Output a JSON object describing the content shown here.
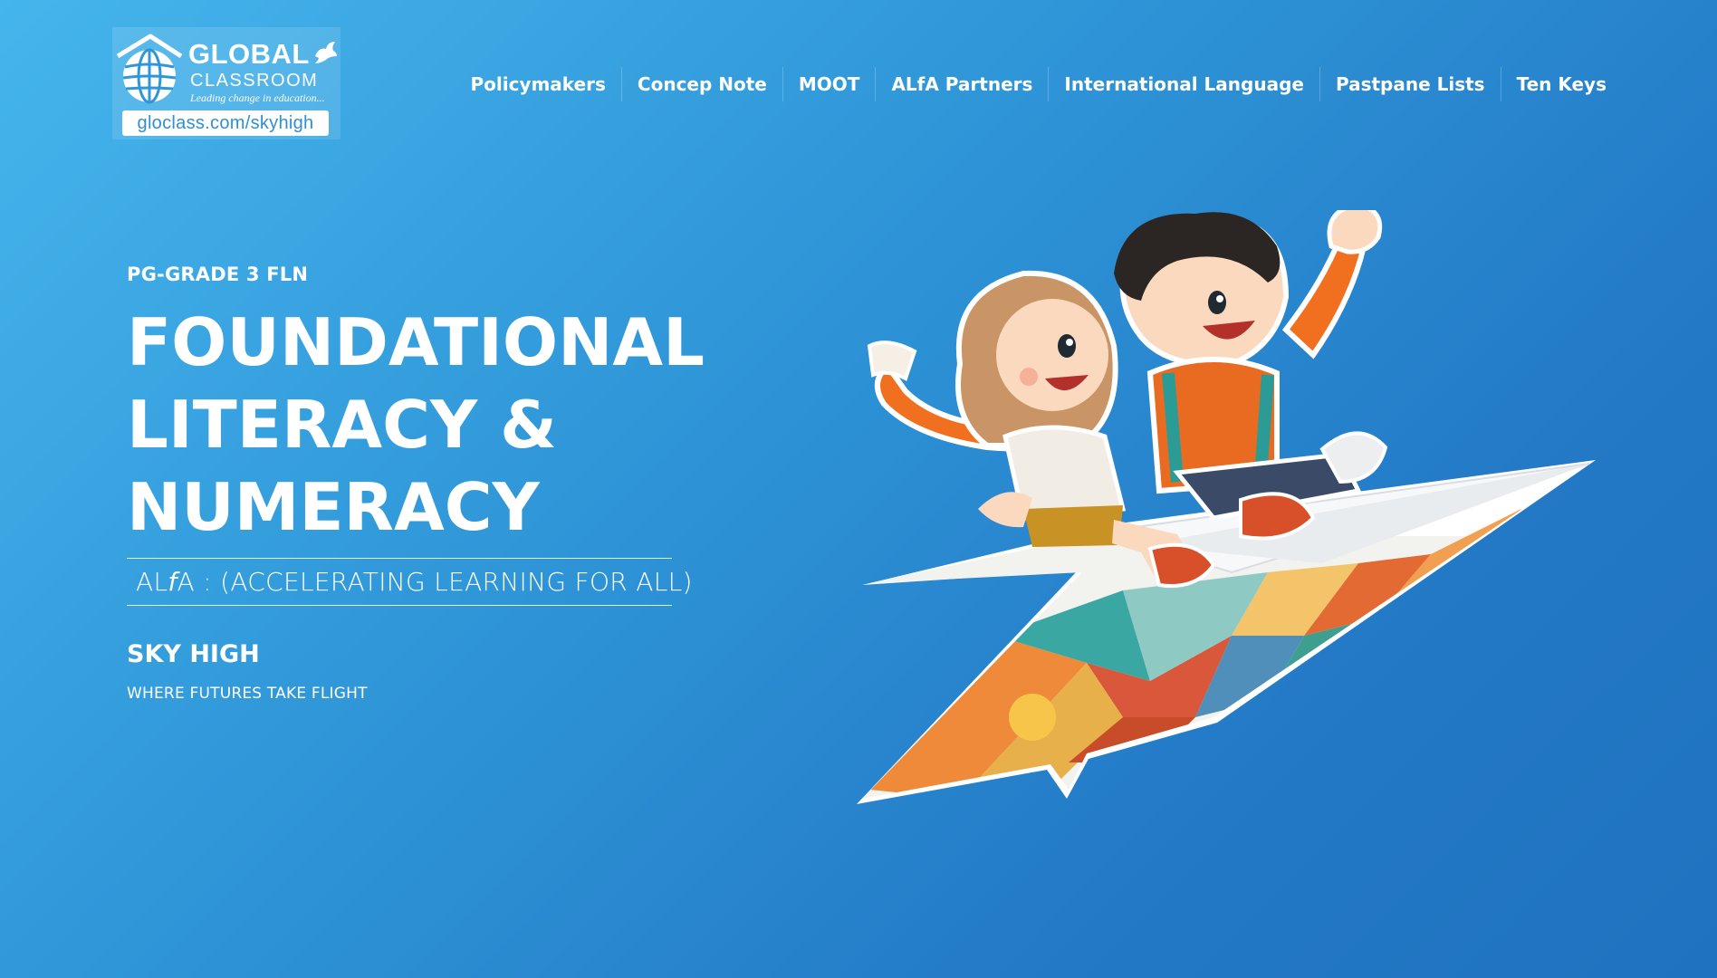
{
  "logo": {
    "brand": "GLOBAL",
    "sub": "CLASSROOM",
    "tagline": "Leading change in education...",
    "url": "gloclass.com/skyhigh"
  },
  "nav": {
    "items": [
      "Policymakers",
      "Concep Note",
      "MOOT",
      "ALfA Partners",
      "International Language",
      "Pastpane Lists",
      "Ten Keys"
    ]
  },
  "hero": {
    "eyebrow": "PG-GRADE 3 FLN",
    "headline": [
      "FOUNDATIONAL",
      "LITERACY &",
      "NUMERACY"
    ],
    "subheadline_prefix": "AL",
    "subheadline_italic": "f",
    "subheadline_suffix": "A : (ACCELERATING LEARNING FOR ALL)",
    "tag_title": "SKY HIGH",
    "tag_sub": "WHERE FUTURES TAKE FLIGHT"
  },
  "colors": {
    "bg_light": "#45b5ec",
    "bg_dark": "#1f72bf",
    "url_text": "#2e8fd4"
  }
}
